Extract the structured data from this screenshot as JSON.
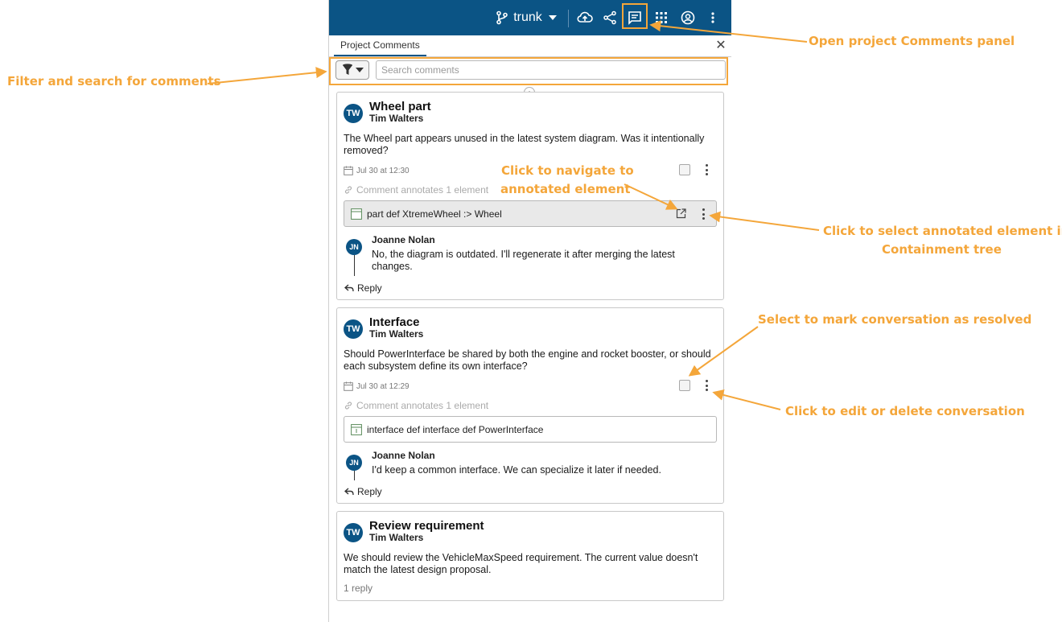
{
  "topbar": {
    "branch": "trunk",
    "bg_color": "#0b5485",
    "icons": [
      "branch-icon",
      "cloud-upload-icon",
      "share-icon",
      "comments-icon",
      "apps-grid-icon",
      "account-icon",
      "more-vert-icon"
    ]
  },
  "tab": {
    "label": "Project Comments"
  },
  "filter": {
    "search_placeholder": "Search comments",
    "search_value": ""
  },
  "comments": [
    {
      "initials": "TW",
      "title": "Wheel part",
      "author": "Tim Walters",
      "body": "The Wheel part appears unused in the latest system diagram. Was it intentionally removed?",
      "date": "Jul 30 at 12:30",
      "annotates": "Comment annotates 1 element",
      "element_badge": "JP",
      "element": "part def  XtremeWheel :> Wheel",
      "reply": {
        "initials": "JN",
        "author": "Joanne Nolan",
        "body": "No, the diagram is outdated. I'll regenerate it after merging the latest changes."
      },
      "reply_label": "Reply"
    },
    {
      "initials": "TW",
      "title": "Interface",
      "author": "Tim Walters",
      "body": "Should PowerInterface be shared by both the engine and rocket booster, or should each subsystem define its own interface?",
      "date": "Jul 30 at 12:29",
      "annotates": "Comment annotates 1 element",
      "element_badge": "IX",
      "element": "interface def  interface def PowerInterface",
      "reply": {
        "initials": "JN",
        "author": "Joanne Nolan",
        "body": "I'd keep a common interface. We can specialize it later if needed."
      },
      "reply_label": "Reply"
    },
    {
      "initials": "TW",
      "title": "Review requirement",
      "author": "Tim Walters",
      "body": "We should review the VehicleMaxSpeed requirement. The current value doesn't match the latest design proposal.",
      "replies_count": "1 reply"
    }
  ],
  "callouts": {
    "open_panel": "Open project Comments panel",
    "filter": "Filter and search for comments",
    "navigate": [
      "Click to navigate to",
      "annotated element"
    ],
    "select": [
      "Click to select annotated element in",
      "Containment tree"
    ],
    "resolve": "Select to mark conversation as resolved",
    "edit": "Click to edit or delete conversation",
    "color": "#f4a63a"
  }
}
